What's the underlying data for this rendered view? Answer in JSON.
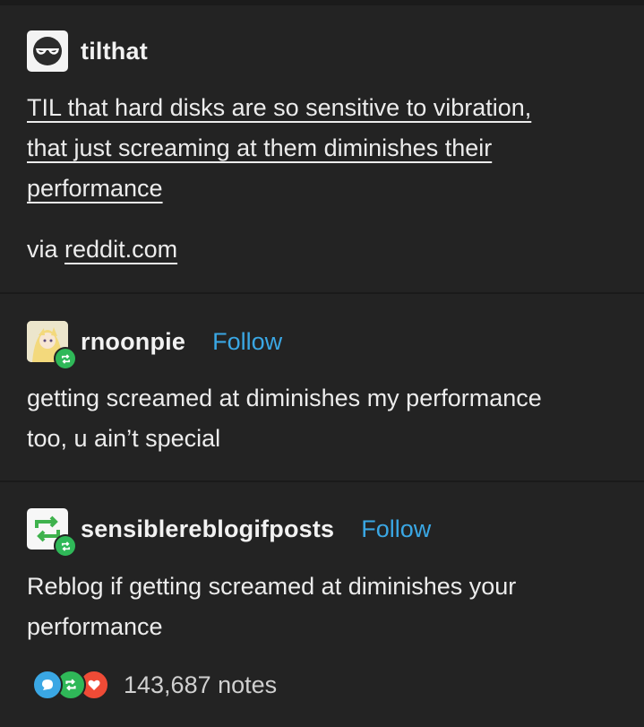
{
  "posts": [
    {
      "username": "tilthat",
      "body_lines": [
        "TIL that hard disks are so sensitive to vibration,",
        "that just screaming at them diminishes their",
        "performance"
      ],
      "via_label": "via",
      "via_link": "reddit.com"
    },
    {
      "username": "rnoonpie",
      "follow_label": "Follow",
      "body_lines": [
        "getting screamed at diminishes my performance",
        "too, u ain’t special"
      ]
    },
    {
      "username": "sensiblereblogifposts",
      "follow_label": "Follow",
      "body_lines": [
        "Reblog if getting screamed at diminishes your",
        "performance"
      ]
    }
  ],
  "notes": {
    "count_label": "143,687 notes",
    "icons": [
      "reply-icon",
      "reblog-icon",
      "like-icon"
    ]
  },
  "colors": {
    "background": "#232323",
    "text": "#ececec",
    "follow": "#3aa7e4",
    "reply": "#3aa7e4",
    "reblog": "#2fb858",
    "like": "#ef4b36"
  }
}
